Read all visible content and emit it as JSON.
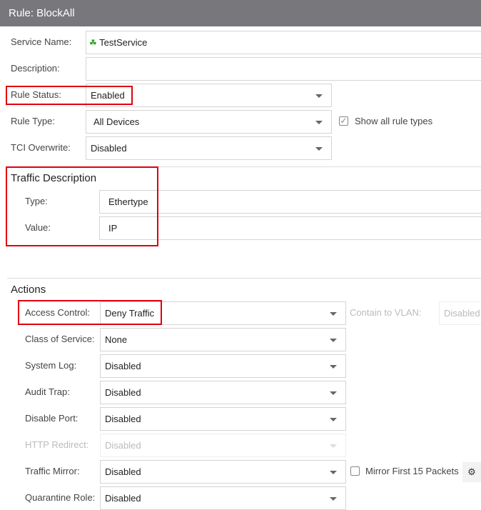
{
  "header": {
    "title": "Rule: BlockAll"
  },
  "general": {
    "service_name": {
      "label": "Service Name:",
      "value": "TestService"
    },
    "description": {
      "label": "Description:",
      "value": ""
    },
    "rule_status": {
      "label": "Rule Status:",
      "value": "Enabled"
    },
    "rule_type": {
      "label": "Rule Type:",
      "value": "All Devices"
    },
    "show_all_rule_types": {
      "label": "Show all rule types",
      "checked": true
    },
    "tci_overwrite": {
      "label": "TCI Overwrite:",
      "value": "Disabled"
    }
  },
  "traffic": {
    "title": "Traffic Description",
    "type": {
      "label": "Type:",
      "value": "Ethertype"
    },
    "value": {
      "label": "Value:",
      "value": "IP"
    }
  },
  "actions": {
    "title": "Actions",
    "access_control": {
      "label": "Access Control:",
      "value": "Deny Traffic"
    },
    "contain_to_vlan": {
      "label": "Contain to VLAN:",
      "value": "Disabled"
    },
    "class_of_service": {
      "label": "Class of Service:",
      "value": "None"
    },
    "system_log": {
      "label": "System Log:",
      "value": "Disabled"
    },
    "audit_trap": {
      "label": "Audit Trap:",
      "value": "Disabled"
    },
    "disable_port": {
      "label": "Disable Port:",
      "value": "Disabled"
    },
    "http_redirect": {
      "label": "HTTP Redirect:",
      "value": "Disabled"
    },
    "traffic_mirror": {
      "label": "Traffic Mirror:",
      "value": "Disabled"
    },
    "mirror_first": {
      "label": "Mirror First 15 Packets",
      "checked": false
    },
    "quarantine_role": {
      "label": "Quarantine Role:",
      "value": "Disabled"
    }
  },
  "colors": {
    "header": "#78777c",
    "highlight": "#e0000f"
  }
}
